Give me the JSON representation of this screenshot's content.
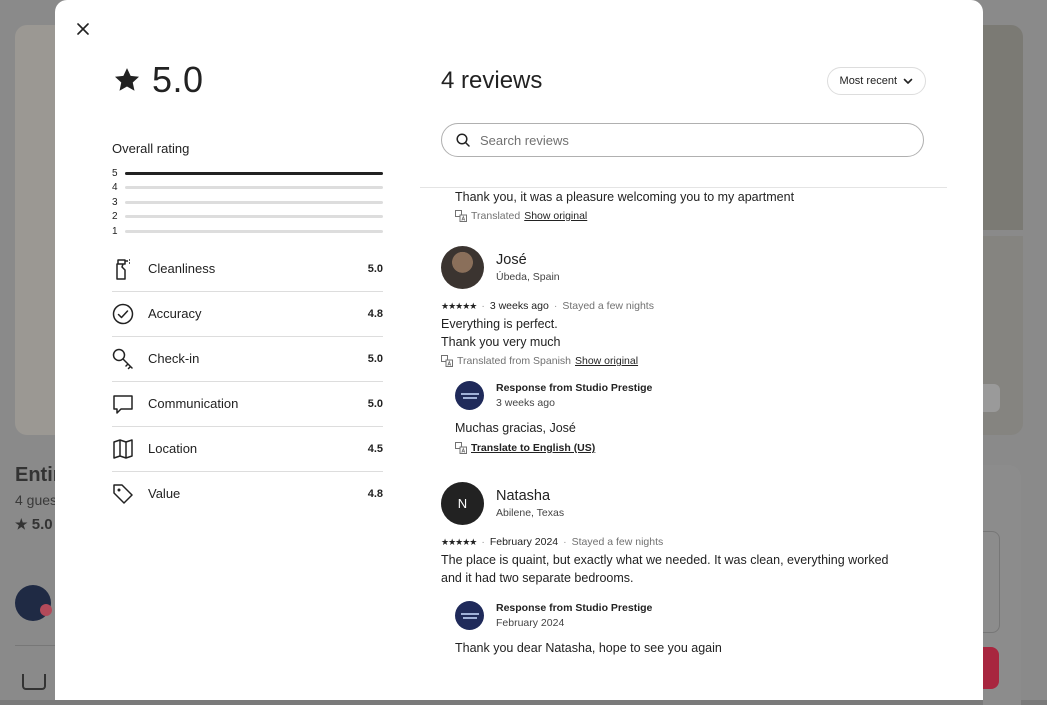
{
  "background": {
    "title": "Entir",
    "subtitle": "4 gues",
    "rating": "5.0"
  },
  "modal": {
    "overall": {
      "value": "5.0",
      "label": "Overall rating",
      "histogram": [
        {
          "stars": "5",
          "fraction": 1.0
        },
        {
          "stars": "4",
          "fraction": 0
        },
        {
          "stars": "3",
          "fraction": 0
        },
        {
          "stars": "2",
          "fraction": 0
        },
        {
          "stars": "1",
          "fraction": 0
        }
      ]
    },
    "categories": [
      {
        "label": "Cleanliness",
        "value": "5.0",
        "icon": "spray-bottle-icon"
      },
      {
        "label": "Accuracy",
        "value": "4.8",
        "icon": "check-circle-icon"
      },
      {
        "label": "Check-in",
        "value": "5.0",
        "icon": "key-icon"
      },
      {
        "label": "Communication",
        "value": "5.0",
        "icon": "chat-bubble-icon"
      },
      {
        "label": "Location",
        "value": "4.5",
        "icon": "map-icon"
      },
      {
        "label": "Value",
        "value": "4.8",
        "icon": "tag-icon"
      }
    ],
    "reviews_title": "4 reviews",
    "sort_label": "Most recent",
    "search_placeholder": "Search reviews",
    "reviews": [
      {
        "response_text": "Thank you, it was a pleasure welcoming you to my apartment",
        "response_translated": "Translated",
        "response_show_original": "Show original"
      },
      {
        "name": "José",
        "location": "Úbeda, Spain",
        "stars": "★★★★★",
        "when": "3 weeks ago",
        "stay": "Stayed a few nights",
        "text_lines": [
          "Everything is perfect.",
          "Thank you very much"
        ],
        "translated_note": "Translated from Spanish",
        "show_original": "Show original",
        "response": {
          "title": "Response from Studio Prestige",
          "date": "3 weeks ago",
          "text": "Muchas gracias, José",
          "translate_link": "Translate to English (US)"
        }
      },
      {
        "name": "Natasha",
        "initial": "N",
        "location": "Abilene, Texas",
        "stars": "★★★★★",
        "when": "February 2024",
        "stay": "Stayed a few nights",
        "text_lines": [
          "The place is quaint, but exactly what we needed. It was clean, everything worked",
          "and it had two separate bedrooms."
        ],
        "response": {
          "title": "Response from Studio Prestige",
          "date": "February 2024",
          "text": "Thank you dear Natasha, hope to see you again"
        }
      }
    ],
    "separator": "·"
  }
}
